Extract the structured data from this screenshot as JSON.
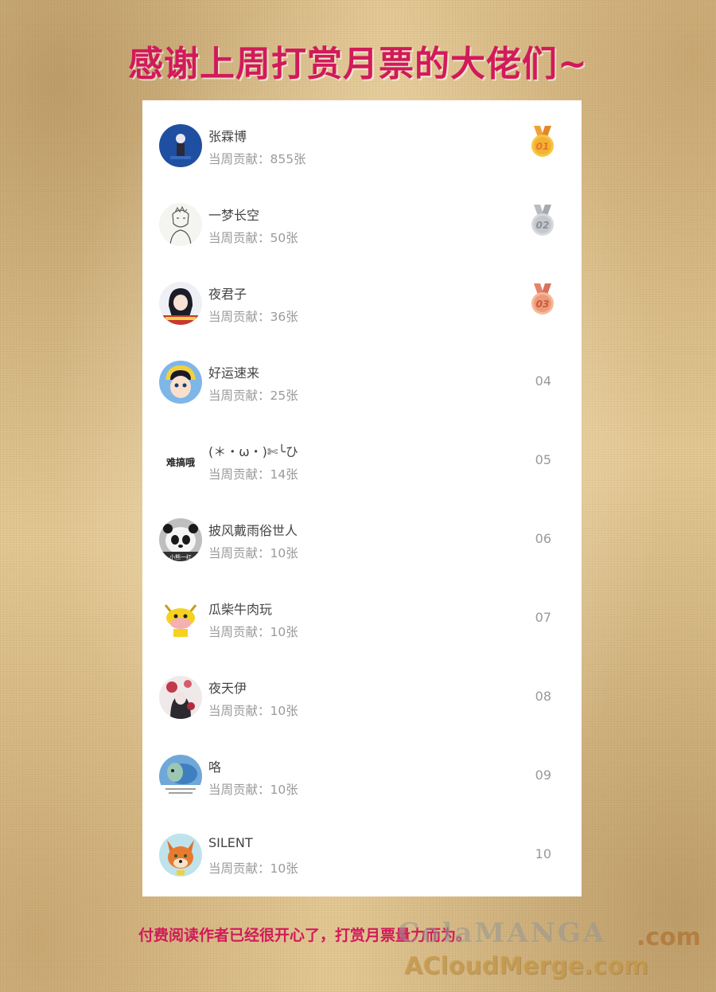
{
  "header": {
    "title": "感谢上周打赏月票的大佬们~"
  },
  "ranking": {
    "entries": [
      {
        "name": "张霖博",
        "contribution": "当周贡献：855张",
        "rank": "01",
        "medal": "gold"
      },
      {
        "name": "一梦长空",
        "contribution": "当周贡献：50张",
        "rank": "02",
        "medal": "silver"
      },
      {
        "name": "夜君子",
        "contribution": "当周贡献：36张",
        "rank": "03",
        "medal": "bronze"
      },
      {
        "name": "好运速来",
        "contribution": "当周贡献：25张",
        "rank": "04"
      },
      {
        "name": "(＊・ω・)✄╰ひ",
        "contribution": "当周贡献：14张",
        "rank": "05"
      },
      {
        "name": "披风戴雨俗世人",
        "contribution": "当周贡献：10张",
        "rank": "06"
      },
      {
        "name": "瓜柴牛肉玩",
        "contribution": "当周贡献：10张",
        "rank": "07"
      },
      {
        "name": "夜天伊",
        "contribution": "当周贡献：10张",
        "rank": "08"
      },
      {
        "name": "咯",
        "contribution": "当周贡献：10张",
        "rank": "09"
      },
      {
        "name": "SILENT",
        "contribution": "当周贡献：10张",
        "rank": "10"
      }
    ],
    "avatar_text": {
      "e05": "难搞哦",
      "e06": "小熊一红"
    }
  },
  "footer": {
    "text": "付费阅读作者已经很开心了，打赏月票量力而为。"
  },
  "watermark": {
    "top": "ColaMANGA",
    "com": ".com",
    "bottom": "ACloudMerge.com"
  },
  "colors": {
    "accent": "#d11a5a",
    "gold": "#f2b233",
    "silver": "#c4c7cc",
    "bronze": "#ec9a78"
  }
}
